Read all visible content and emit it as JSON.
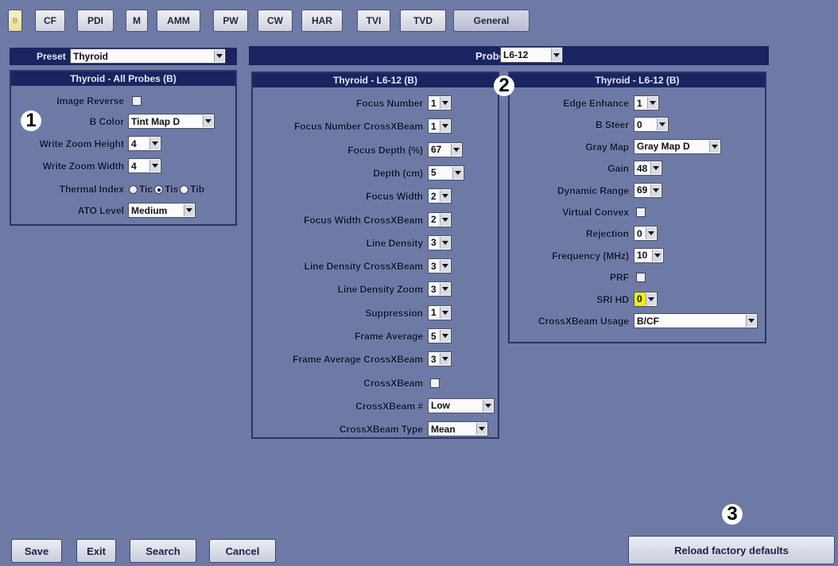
{
  "tabs": [
    "B",
    "CF",
    "PDI",
    "M",
    "AMM",
    "PW",
    "CW",
    "HAR",
    "TVI",
    "TVD",
    "General"
  ],
  "preset": {
    "label": "Preset",
    "value": "Thyroid"
  },
  "probe": {
    "label": "Probe",
    "value": "L6-12"
  },
  "panel1": {
    "title": "Thyroid - All Probes (B)",
    "image_reverse": "Image Reverse",
    "b_color": {
      "label": "B Color",
      "value": "Tint Map D"
    },
    "write_zoom_height": {
      "label": "Write Zoom Height",
      "value": "4"
    },
    "write_zoom_width": {
      "label": "Write Zoom Width",
      "value": "4"
    },
    "thermal_index": {
      "label": "Thermal Index",
      "options": [
        "Tic",
        "Tis",
        "Tib"
      ],
      "selected": "Tis"
    },
    "ato_level": {
      "label": "ATO Level",
      "value": "Medium"
    }
  },
  "panel2": {
    "title": "Thyroid - L6-12 (B)",
    "rows": [
      {
        "label": "Focus Number",
        "value": "1"
      },
      {
        "label": "Focus Number CrossXBeam",
        "value": "1"
      },
      {
        "label": "Focus Depth (%)",
        "value": "67"
      },
      {
        "label": "Depth (cm)",
        "value": "5"
      },
      {
        "label": "Focus Width",
        "value": "2"
      },
      {
        "label": "Focus Width CrossXBeam",
        "value": "2"
      },
      {
        "label": "Line Density",
        "value": "3"
      },
      {
        "label": "Line Density CrossXBeam",
        "value": "3"
      },
      {
        "label": "Line Density Zoom",
        "value": "3"
      },
      {
        "label": "Suppression",
        "value": "1"
      },
      {
        "label": "Frame Average",
        "value": "5"
      },
      {
        "label": "Frame Average CrossXBeam",
        "value": "3"
      },
      {
        "label": "CrossXBeam",
        "value": ""
      },
      {
        "label": "CrossXBeam #",
        "value": "Low"
      },
      {
        "label": "CrossXBeam Type",
        "value": "Mean"
      }
    ]
  },
  "panel3": {
    "title": "Thyroid - L6-12 (B)",
    "rows": [
      {
        "label": "Edge Enhance",
        "value": "1"
      },
      {
        "label": "B Steer",
        "value": "0"
      },
      {
        "label": "Gray Map",
        "value": "Gray Map D"
      },
      {
        "label": "Gain",
        "value": "48"
      },
      {
        "label": "Dynamic Range",
        "value": "69"
      },
      {
        "label": "Virtual Convex",
        "value": ""
      },
      {
        "label": "Rejection",
        "value": "0"
      },
      {
        "label": "Frequency (MHz)",
        "value": "10"
      },
      {
        "label": "PRF",
        "value": ""
      },
      {
        "label": "SRI HD",
        "value": "0"
      },
      {
        "label": "CrossXBeam Usage",
        "value": "B/CF"
      }
    ]
  },
  "callouts": [
    "1",
    "2",
    "3"
  ],
  "buttons": {
    "save": "Save",
    "exit": "Exit",
    "search": "Search",
    "cancel": "Cancel",
    "reload": "Reload factory defaults"
  },
  "colors": {
    "background": "#6d7aa6",
    "header": "#1a2460",
    "highlight": "#f0f000"
  }
}
